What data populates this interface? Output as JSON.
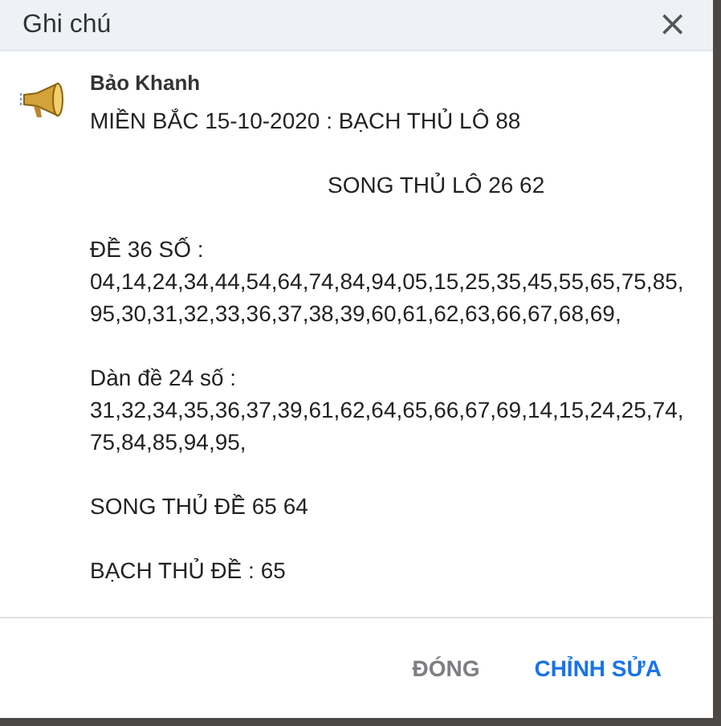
{
  "dialog": {
    "title": "Ghi chú",
    "close_glyph": "×"
  },
  "note": {
    "author": "Bảo Khanh",
    "paragraphs": [
      {
        "kind": "plain",
        "lines": [
          "MIỀN BẮC 15-10-2020 : BẠCH THỦ LÔ 88"
        ]
      },
      {
        "kind": "indented",
        "lines": [
          "SONG THỦ LÔ 26 62"
        ]
      },
      {
        "kind": "plain",
        "lines": [
          "ĐỀ 36 SỐ :",
          "04,14,24,34,44,54,64,74,84,94,05,15,25,35,45,55,65,75,85,",
          "95,30,31,32,33,36,37,38,39,60,61,62,63,66,67,68,69,"
        ]
      },
      {
        "kind": "plain",
        "lines": [
          "Dàn đề 24 số :",
          "31,32,34,35,36,37,39,61,62,64,65,66,67,69,14,15,24,25,74,",
          "75,84,85,94,95,"
        ]
      },
      {
        "kind": "plain",
        "lines": [
          "SONG THỦ ĐỀ 65 64"
        ]
      },
      {
        "kind": "plain",
        "lines": [
          "BẠCH THỦ ĐỀ : 65"
        ]
      }
    ]
  },
  "buttons": [
    {
      "label": "ĐÓNG",
      "kind": "secondary"
    },
    {
      "label": "CHỈNH SỬA",
      "kind": "primary"
    }
  ]
}
